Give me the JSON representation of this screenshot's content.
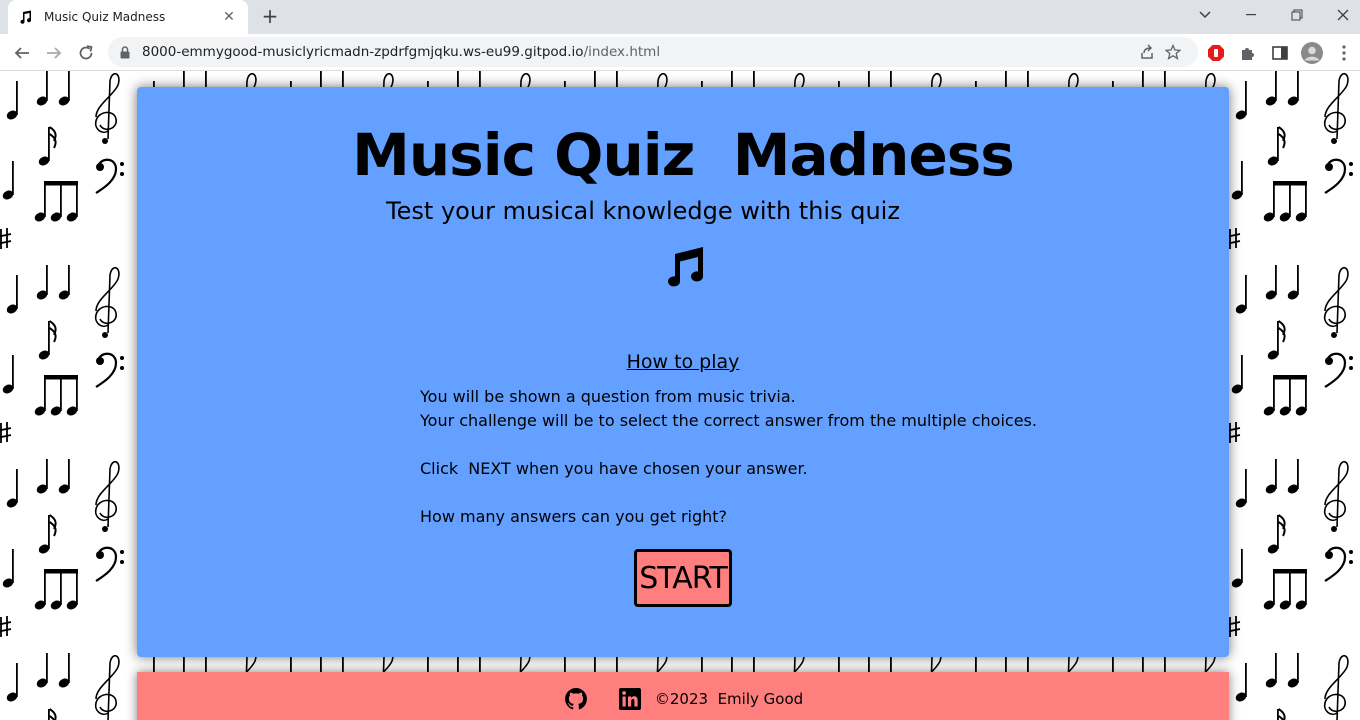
{
  "browser": {
    "tab_title": "Music Quiz Madness",
    "url_host": "8000-emmygood-musiclyricmadn-zpdrfgmjqku.ws-eu99.gitpod.io",
    "url_path": "/index.html"
  },
  "header": {
    "title": "Music Quiz  Madness",
    "subtitle": "Test your musical knowledge with this quiz",
    "icon": "music-notes-icon"
  },
  "how_to_play": {
    "heading": "How to play",
    "line1": "You will be shown a question from music trivia.",
    "line2": "Your challenge will be to select the correct answer from the multiple choices.",
    "line3": "Click  NEXT when you have chosen your answer.",
    "line4": "How many answers can you get right?"
  },
  "start_button": {
    "label": "START"
  },
  "footer": {
    "copyright": "©2023  Emily Good",
    "icons": [
      "github-icon",
      "linkedin-icon"
    ]
  },
  "colors": {
    "card": "#63a0ff",
    "button": "#ff7f7f",
    "footer": "#ff7f7f"
  }
}
